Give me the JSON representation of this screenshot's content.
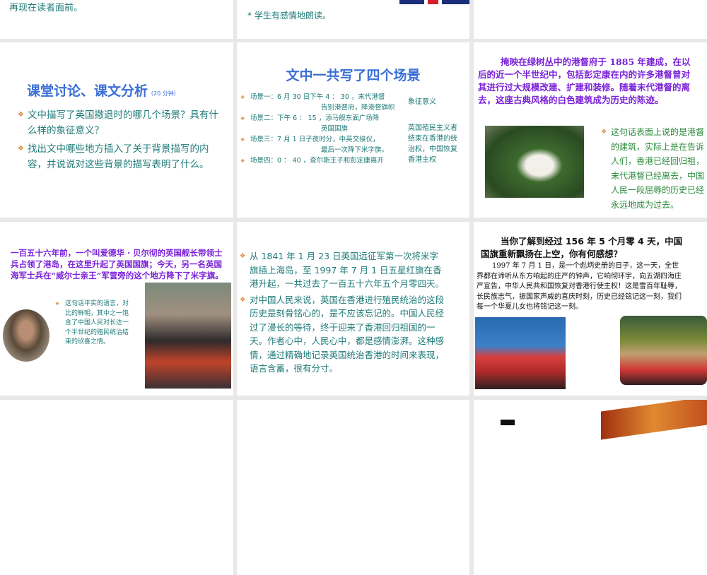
{
  "slides": [
    {
      "text": "再现在读者面前。"
    },
    {
      "text": "* 学生有感情地朗读。"
    },
    {},
    {
      "title": "课堂讨论、课文分析",
      "duration": "（20 分钟）",
      "bullets": [
        "文中描写了英国撤退时的哪几个场景？具有什么样的象征意义？",
        "找出文中哪些地方插入了关于背景描写的内容，并说说对这些背景的描写表明了什么。"
      ]
    },
    {
      "title": "文中一共写了四个场景",
      "scenes": [
        {
          "label": "场景一：",
          "line1": "6 月 30 日下午 4 ： 30 ，末代港督",
          "line2": "告别港督府，降港督旗帜"
        },
        {
          "label": "场景二：",
          "line1": "下午 6 ： 15 ，添马舰东面广场降",
          "line2": "英国国旗"
        },
        {
          "label": "场景三：",
          "line1": "7 月 1 日子夜时分，中英交接仪，",
          "line2": "最后一次降下米字旗。"
        },
        {
          "label": "场景四：",
          "line1": "0 ： 40 ，查尔斯王子和彭定康离开",
          "line2": ""
        }
      ],
      "meaning_title": "象征意义",
      "meaning": "英国殖民主义者结束在香港的统治权，中国恢复香港主权"
    },
    {
      "quote": "掩映在绿树丛中的港督府于 1885 年建成，在以后的近一个半世纪中，包括彭定康在内的许多港督曾对其进行过大规模改建、扩建和装修。随着末代港督的离去，这座古典风格的白色建筑成为历史的陈迹。",
      "note": "这句话表面上说的是港督的建筑，实际上是在告诉人们，香港已经回归祖，末代港督已经离去，中国人民一段屈辱的历史已经永远地成为过去。"
    },
    {
      "quote": "一百五十六年前，一个叫爱德华 · 贝尔彻的英国舰长带领士兵占领了港岛，在这里升起了英国国旗；今天，另一名英国海军士兵在“威尔士亲王”军营旁的这个地方降下了米字旗。",
      "note": "这句话平实的语言，对比的鲜明，其中之一饱含了中国人民对长达一个半世纪的殖民统治结束的欣喜之情。"
    },
    {
      "bullets": [
        "从 1841 年 1 月 23 日英国远征军第一次将米字旗插上海岛，至 1997 年 7 月 1 日五星红旗在香港升起，一共过去了一百五十六年五个月零四天。",
        "对中国人民来说，英国在香港进行殖民统治的这段历史是刻骨铭心的，是不应该忘记的。中国人民经过了漫长的等待，终于迎来了香港回归祖国的一天。作者心中，人民心中，都是感情澎湃。这种感情，通过精确地记录英国统治香港的时间来表现，语言含蓄，很有分寸。"
      ]
    },
    {
      "question": "当你了解到经过 156 年 5 个月零 4 天，中国国旗重新飘扬在上空，你有何感想？",
      "body": "1997 年 7 月 1 日，是一个彪炳史册的日子，这一天，全世界都在谛听从东方响起的庄严的钟声，它响彻环宇，向五湖四海庄严宣告，中华人民共和国恢复对香港行使主权！这是雪百年耻辱，长民族志气，振国家声威的喜庆时刻，历史已经铭记这一刻，我们每一个华夏儿女也将铭记这一刻。"
    }
  ],
  "colors": {
    "teal": "#1e7b78",
    "blue": "#3a6fd6",
    "purple": "#7a22d8",
    "gap": "#e8e8e8"
  }
}
